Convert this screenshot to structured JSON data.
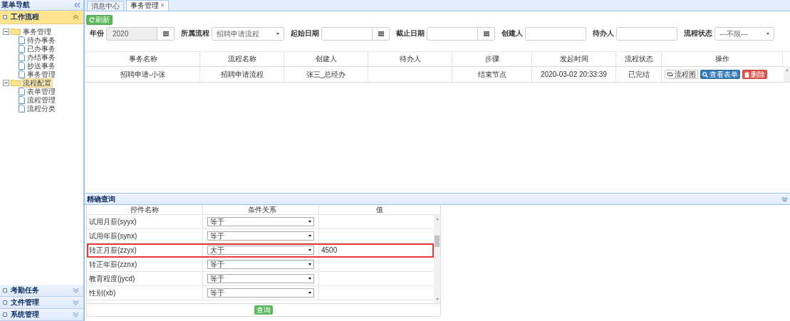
{
  "sidebar": {
    "title": "菜单导航",
    "sections": [
      {
        "label": "工作流程",
        "expanded": true,
        "tree": [
          {
            "label": "事务管理",
            "kind": "folder",
            "expanded": true,
            "selected": false,
            "children": [
              {
                "label": "待办事务",
                "kind": "file",
                "selected": false
              },
              {
                "label": "已办事务",
                "kind": "file",
                "selected": false
              },
              {
                "label": "办结事务",
                "kind": "file",
                "selected": false
              },
              {
                "label": "抄送事务",
                "kind": "file",
                "selected": false
              },
              {
                "label": "事务管理",
                "kind": "file",
                "selected": false
              }
            ]
          },
          {
            "label": "流程配置",
            "kind": "folder",
            "expanded": true,
            "selected": true,
            "children": [
              {
                "label": "表单管理",
                "kind": "file",
                "selected": false
              },
              {
                "label": "流程管理",
                "kind": "file",
                "selected": false
              },
              {
                "label": "流程分类",
                "kind": "file",
                "selected": false
              }
            ]
          }
        ]
      },
      {
        "label": "考勤任务",
        "expanded": false
      },
      {
        "label": "文件管理",
        "expanded": false
      },
      {
        "label": "系统管理",
        "expanded": false
      }
    ]
  },
  "tabs": [
    {
      "label": "消息中心",
      "selected": false,
      "closable": false
    },
    {
      "label": "事务管理",
      "selected": true,
      "closable": true,
      "close": "×"
    }
  ],
  "toolbar": {
    "refresh": "刷新"
  },
  "filters": [
    {
      "label": "年份",
      "kind": "date",
      "value": "2020",
      "disabled": true
    },
    {
      "label": "所属流程",
      "kind": "select",
      "value": "招聘申请流程"
    },
    {
      "label": "起始日期",
      "kind": "date",
      "disabled": false
    },
    {
      "label": "截止日期",
      "kind": "date",
      "disabled": false
    },
    {
      "label": "创建人",
      "kind": "text"
    },
    {
      "label": "待办人",
      "kind": "text"
    },
    {
      "label": "流程状态",
      "kind": "select",
      "value": "---不限---"
    }
  ],
  "table": {
    "columns": [
      "事务名称",
      "流程名称",
      "创建人",
      "待办人",
      "步骤",
      "发起时间",
      "流程状态",
      "操作"
    ],
    "rows": [
      {
        "cells": [
          "招聘申请-小张",
          "招聘申请流程",
          "张三_总经办",
          "",
          "结束节点",
          "2020-03-02 20:33:39",
          "已完结"
        ],
        "actions": [
          {
            "label": "流程图",
            "kind": "flow"
          },
          {
            "label": "查看表单",
            "kind": "view"
          },
          {
            "label": "删除",
            "kind": "delete"
          }
        ]
      }
    ]
  },
  "query": {
    "title": "精确查询",
    "columns": [
      "控件名称",
      "条件关系",
      "值"
    ],
    "rows": [
      {
        "name": "试用月薪(syyx)",
        "condition": "等于",
        "highlighted": false
      },
      {
        "name": "试用年薪(synx)",
        "condition": "等于",
        "highlighted": false
      },
      {
        "name": "转正月薪(zzyx)",
        "condition": "大于",
        "value": "4500",
        "highlighted": true
      },
      {
        "name": "转正年薪(zznx)",
        "condition": "等于",
        "highlighted": false
      },
      {
        "name": "教育程度(jycd)",
        "condition": "等于",
        "highlighted": false
      },
      {
        "name": "性别(xb)",
        "condition": "等于",
        "highlighted": false
      }
    ],
    "button": "查询"
  }
}
